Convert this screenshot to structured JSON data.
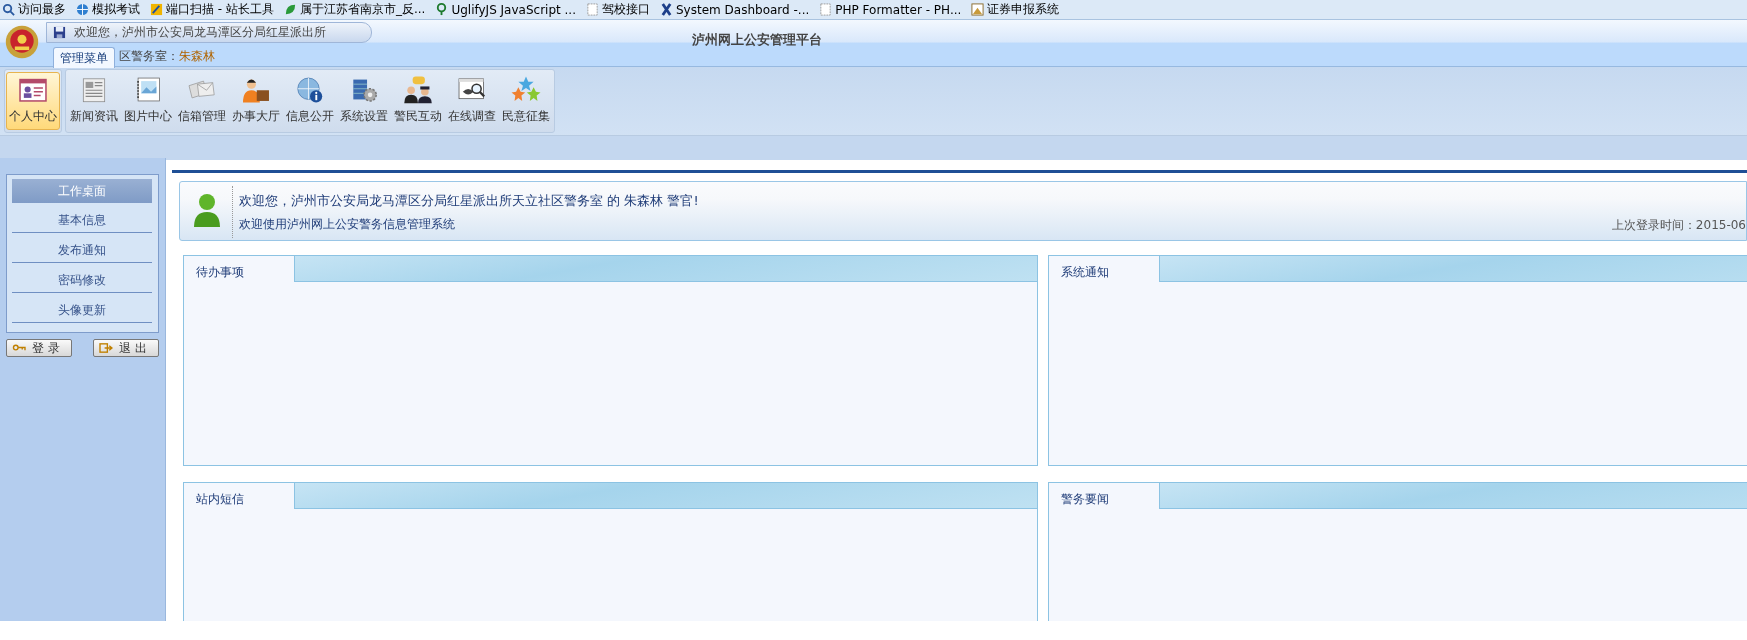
{
  "bookmarks": [
    {
      "label": "访问最多"
    },
    {
      "label": "模拟考试"
    },
    {
      "label": "端口扫描 - 站长工具"
    },
    {
      "label": "属于江苏省南京市_反..."
    },
    {
      "label": "UglifyJS JavaScript ..."
    },
    {
      "label": "驾校接口"
    },
    {
      "label": "System Dashboard -..."
    },
    {
      "label": "PHP Formatter - PH..."
    },
    {
      "label": "证券申报系统"
    }
  ],
  "header": {
    "greeting": "欢迎您，泸州市公安局龙马潭区分局红星派出所",
    "office_fragment": "区警务室：",
    "officer": "朱森林",
    "title": "泸州网上公安管理平台"
  },
  "menu_tab": {
    "label": "管理菜单",
    "selected": true
  },
  "toolbar": {
    "items": [
      {
        "label": "个人中心",
        "selected": true
      },
      {
        "label": "新闻资讯",
        "selected": false
      },
      {
        "label": "图片中心",
        "selected": false
      },
      {
        "label": "信箱管理",
        "selected": false
      },
      {
        "label": "办事大厅",
        "selected": false
      },
      {
        "label": "信息公开",
        "selected": false
      },
      {
        "label": "系统设置",
        "selected": false
      },
      {
        "label": "警民互动",
        "selected": false
      },
      {
        "label": "在线调查",
        "selected": false
      },
      {
        "label": "民意征集",
        "selected": false
      }
    ]
  },
  "sidebar": {
    "items": [
      {
        "label": "工作桌面",
        "selected": true
      },
      {
        "label": "基本信息",
        "selected": false
      },
      {
        "label": "发布通知",
        "selected": false
      },
      {
        "label": "密码修改",
        "selected": false
      },
      {
        "label": "头像更新",
        "selected": false
      }
    ],
    "buttons": [
      "登 录",
      "退 出"
    ]
  },
  "welcome": {
    "message": "欢迎您，泸州市公安局龙马潭区分局红星派出所天立社区警务室 的 朱森林 警官!",
    "subtitle": "欢迎使用泸州网上公安警务信息管理系统",
    "last_login": "上次登录时间：2015-06"
  },
  "panels": [
    {
      "title": "待办事项"
    },
    {
      "title": "系统通知"
    },
    {
      "title": "站内短信"
    },
    {
      "title": "警务要闻"
    }
  ]
}
